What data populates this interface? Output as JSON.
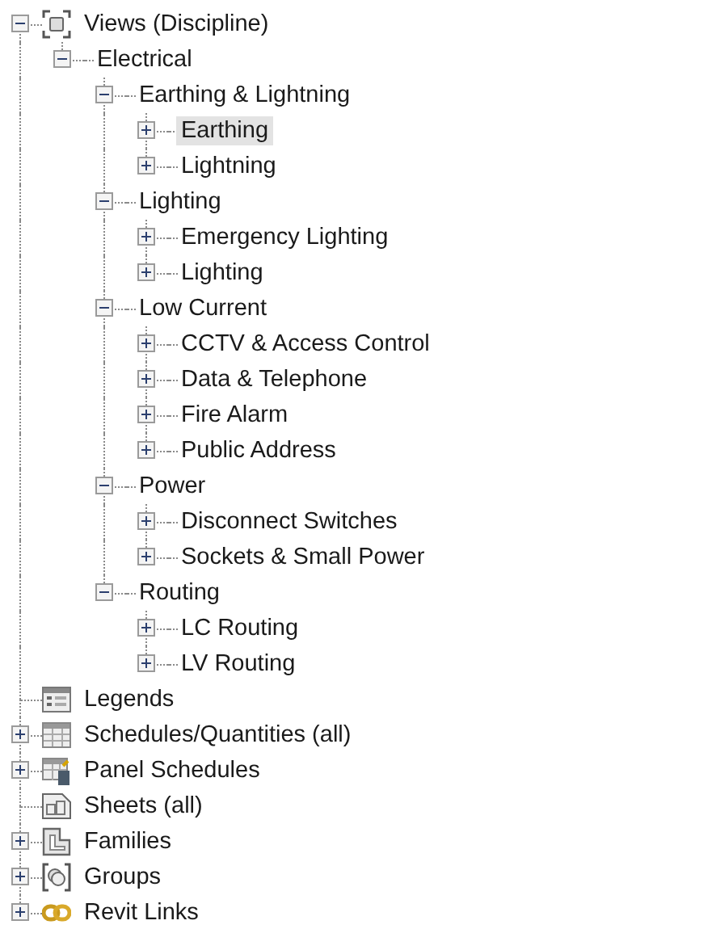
{
  "tree": [
    {
      "label": "Views (Discipline)",
      "kind": "views",
      "expanded": true,
      "selected": false,
      "children": [
        {
          "label": "Electrical",
          "kind": "folder",
          "expanded": true,
          "selected": false,
          "children": [
            {
              "label": "Earthing & Lightning",
              "kind": "folder",
              "expanded": true,
              "selected": false,
              "children": [
                {
                  "label": "Earthing",
                  "kind": "folder",
                  "expanded": false,
                  "selected": true
                },
                {
                  "label": "Lightning",
                  "kind": "folder",
                  "expanded": false,
                  "selected": false
                }
              ]
            },
            {
              "label": "Lighting",
              "kind": "folder",
              "expanded": true,
              "selected": false,
              "children": [
                {
                  "label": "Emergency Lighting",
                  "kind": "folder",
                  "expanded": false,
                  "selected": false
                },
                {
                  "label": "Lighting",
                  "kind": "folder",
                  "expanded": false,
                  "selected": false
                }
              ]
            },
            {
              "label": "Low Current",
              "kind": "folder",
              "expanded": true,
              "selected": false,
              "children": [
                {
                  "label": "CCTV & Access Control",
                  "kind": "folder",
                  "expanded": false,
                  "selected": false
                },
                {
                  "label": "Data & Telephone",
                  "kind": "folder",
                  "expanded": false,
                  "selected": false
                },
                {
                  "label": "Fire Alarm",
                  "kind": "folder",
                  "expanded": false,
                  "selected": false
                },
                {
                  "label": "Public Address",
                  "kind": "folder",
                  "expanded": false,
                  "selected": false
                }
              ]
            },
            {
              "label": "Power",
              "kind": "folder",
              "expanded": true,
              "selected": false,
              "children": [
                {
                  "label": "Disconnect Switches",
                  "kind": "folder",
                  "expanded": false,
                  "selected": false
                },
                {
                  "label": "Sockets & Small Power",
                  "kind": "folder",
                  "expanded": false,
                  "selected": false
                }
              ]
            },
            {
              "label": "Routing",
              "kind": "folder",
              "expanded": true,
              "selected": false,
              "children": [
                {
                  "label": "LC Routing",
                  "kind": "folder",
                  "expanded": false,
                  "selected": false
                },
                {
                  "label": "LV Routing",
                  "kind": "folder",
                  "expanded": false,
                  "selected": false
                }
              ]
            }
          ]
        }
      ]
    },
    {
      "label": "Legends",
      "kind": "legends",
      "selected": false
    },
    {
      "label": "Schedules/Quantities (all)",
      "kind": "schedules",
      "expanded": false,
      "selected": false
    },
    {
      "label": "Panel Schedules",
      "kind": "panel-schedules",
      "expanded": false,
      "selected": false
    },
    {
      "label": "Sheets (all)",
      "kind": "sheets",
      "selected": false
    },
    {
      "label": "Families",
      "kind": "families",
      "expanded": false,
      "selected": false
    },
    {
      "label": "Groups",
      "kind": "groups",
      "expanded": false,
      "selected": false
    },
    {
      "label": "Revit Links",
      "kind": "links",
      "expanded": false,
      "selected": false
    }
  ]
}
